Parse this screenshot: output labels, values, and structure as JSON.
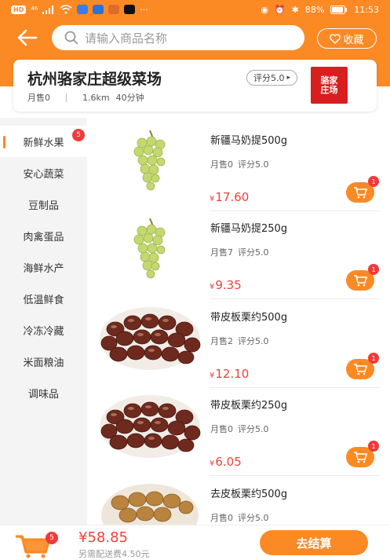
{
  "status_bar": {
    "sim": "HD",
    "signal": "⁴⁶",
    "battery": "88%",
    "time": "11:53"
  },
  "header": {
    "search_placeholder": "请输入商品名称",
    "favorite_label": "收藏"
  },
  "store": {
    "name": "杭州骆家庄超级菜场",
    "rating": "评分5.0",
    "monthly_sales": "月售0",
    "distance": "1.6km",
    "delivery_time": "40分钟",
    "logo_text": [
      "骆家",
      "庄场"
    ]
  },
  "categories": [
    {
      "label": "新鲜水果",
      "active": true,
      "badge": "5"
    },
    {
      "label": "安心蔬菜"
    },
    {
      "label": "豆制品"
    },
    {
      "label": "肉禽蛋品"
    },
    {
      "label": "海鲜水产"
    },
    {
      "label": "低温鲜食"
    },
    {
      "label": "冷冻冷藏"
    },
    {
      "label": "米面粮油"
    },
    {
      "label": "调味品"
    }
  ],
  "products": [
    {
      "name": "新疆马奶提500g",
      "sales": "月售0",
      "rating": "评分5.0",
      "currency": "¥",
      "price": "17.60",
      "cart_count": "1",
      "image": "grapes"
    },
    {
      "name": "新疆马奶提250g",
      "sales": "月售7",
      "rating": "评分5.0",
      "currency": "¥",
      "price": "9.35",
      "cart_count": "1",
      "image": "grapes"
    },
    {
      "name": "带皮板栗约500g",
      "sales": "月售2",
      "rating": "评分5.0",
      "currency": "¥",
      "price": "12.10",
      "cart_count": "1",
      "image": "chestnuts"
    },
    {
      "name": "带皮板栗约250g",
      "sales": "月售0",
      "rating": "评分5.0",
      "currency": "¥",
      "price": "6.05",
      "cart_count": "1",
      "image": "chestnuts"
    },
    {
      "name": "去皮板栗约500g",
      "sales": "月售0",
      "rating": "评分5.0",
      "image": "peeled-chestnuts"
    }
  ],
  "bottom_bar": {
    "cart_badge": "5",
    "total": "¥58.85",
    "delivery_note": "另需配送费4.50元",
    "checkout_label": "去结算"
  },
  "colors": {
    "accent": "#fb8a25",
    "price": "#f0413c",
    "badge": "#f03a3a"
  }
}
